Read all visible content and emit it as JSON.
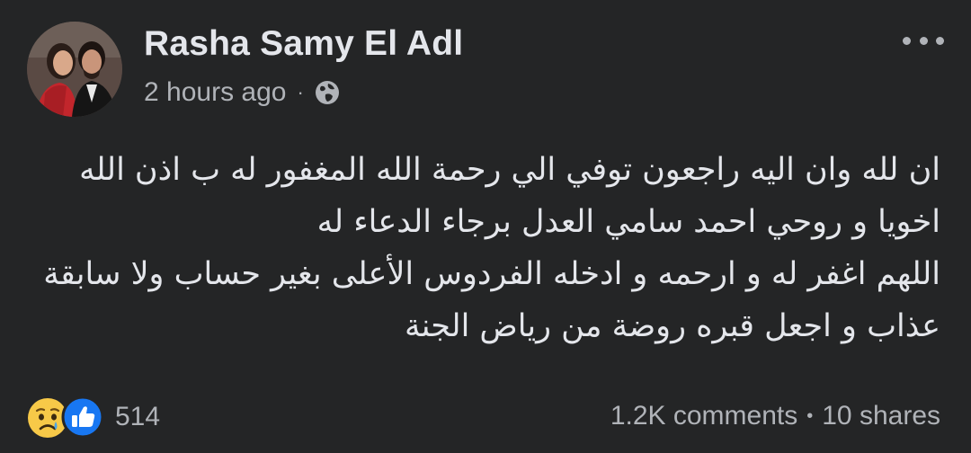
{
  "post": {
    "author": "Rasha Samy El Adl",
    "timestamp": "2 hours ago",
    "meta_separator": "·",
    "privacy_icon": "globe-icon",
    "more_icon": "more-options-icon",
    "body_lines": [
      "ان لله وان اليه راجعون توفي الي رحمة الله المغفور له ب اذن الله",
      "اخويا و روحي احمد سامي العدل برجاء الدعاء له",
      "اللهم اغفر له و ارحمه و ادخله الفردوس الأعلى بغير حساب ولا سابقة",
      "عذاب و اجعل قبره روضة من رياض الجنة"
    ],
    "reactions": {
      "icons": [
        "sad-icon",
        "like-icon"
      ],
      "count": "514"
    },
    "engagement": {
      "comments": "1.2K comments",
      "separator": "•",
      "shares": "10 shares"
    }
  },
  "colors": {
    "background": "#242526",
    "primary_text": "#e4e6eb",
    "secondary_text": "#b0b3b8",
    "like_blue": "#1877f2",
    "sad_yellow": "#f7c948"
  }
}
